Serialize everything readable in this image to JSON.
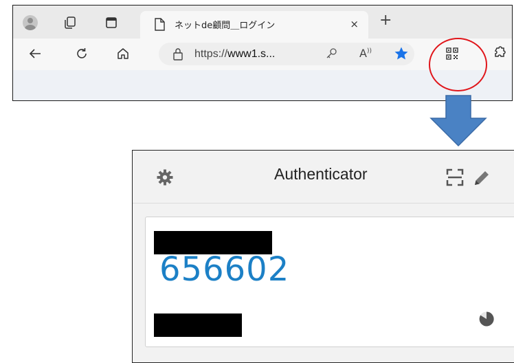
{
  "browser": {
    "tab": {
      "title": "ネットde顧問＿ログイン",
      "close_glyph": "×"
    },
    "new_tab_glyph": "+",
    "address_bar": {
      "url_prefix": "https://",
      "url_host": "www1.s..."
    },
    "icons": [
      "profile-avatar-icon",
      "workspaces-icon",
      "tab-actions-icon",
      "page-icon",
      "back-icon",
      "refresh-icon",
      "home-icon",
      "lock-icon",
      "key-icon",
      "read-aloud-icon",
      "favorite-star-icon",
      "qr-extension-icon",
      "extensions-icon"
    ],
    "highlight_color": "#e0161b"
  },
  "arrow": {
    "color": "#4a82c4"
  },
  "authenticator": {
    "title": "Authenticator",
    "entries": [
      {
        "code": "656602"
      }
    ],
    "code_color": "#1c80c6",
    "icons": [
      "settings-gear-icon",
      "scan-qr-icon",
      "edit-pencil-icon",
      "timer-pie-icon"
    ]
  }
}
